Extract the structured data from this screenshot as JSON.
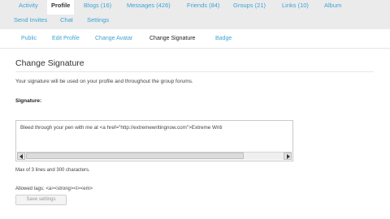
{
  "topnav": {
    "row1": [
      {
        "label": "Activity",
        "active": false
      },
      {
        "label": "Profile",
        "active": true
      },
      {
        "label": "Blogs (16)",
        "active": false
      },
      {
        "label": "Messages (426)",
        "active": false
      },
      {
        "label": "Friends (84)",
        "active": false
      },
      {
        "label": "Groups (21)",
        "active": false
      },
      {
        "label": "Links (10)",
        "active": false
      },
      {
        "label": "Album",
        "active": false
      }
    ],
    "row2": [
      {
        "label": "Send Invites"
      },
      {
        "label": "Chat"
      },
      {
        "label": "Settings"
      }
    ]
  },
  "subnav": [
    {
      "label": "Public",
      "active": false
    },
    {
      "label": "Edit Profile",
      "active": false
    },
    {
      "label": "Change Avatar",
      "active": false
    },
    {
      "label": "Change Signature",
      "active": true
    },
    {
      "label": "Badge",
      "active": false
    }
  ],
  "content": {
    "heading": "Change Signature",
    "description": "Your signature will be used on your profile and throughout the group forums.",
    "signature_label": "Signature:",
    "signature_value": "Bleed through your pen with me at <a href=\"http://extremewritingnow.com\">Extreme Writi",
    "hint": "Max of 3 lines and 300 characters.",
    "allowed_tags": "Allowed tags: <a><strong><i><em>",
    "save_button": "Save settings"
  },
  "colors": {
    "link": "#3da3d4",
    "nav_bg": "#ebebeb",
    "text": "#333333"
  }
}
